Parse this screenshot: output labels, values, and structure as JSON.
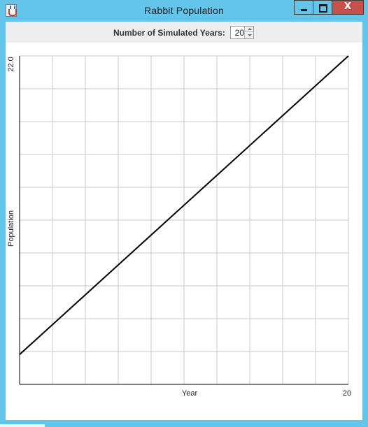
{
  "window": {
    "title": "Rabbit Population",
    "close_label": "X",
    "accent_color": "#63c5ea",
    "close_color": "#c7504a"
  },
  "toolbar": {
    "years_label": "Number of Simulated Years:",
    "years_value": "20"
  },
  "chart_data": {
    "type": "line",
    "title": "",
    "xlabel": "Year",
    "ylabel": "Population",
    "x_tick_labels": [
      "20"
    ],
    "y_tick_labels": [
      "22.0"
    ],
    "xlim": [
      0,
      20
    ],
    "ylim": [
      0,
      22.0
    ],
    "grid": true,
    "grid_divisions": {
      "x": 10,
      "y": 10
    },
    "line_color": "#000000",
    "series": [
      {
        "x": [
          0,
          20
        ],
        "values": [
          2.0,
          22.0
        ]
      }
    ]
  }
}
